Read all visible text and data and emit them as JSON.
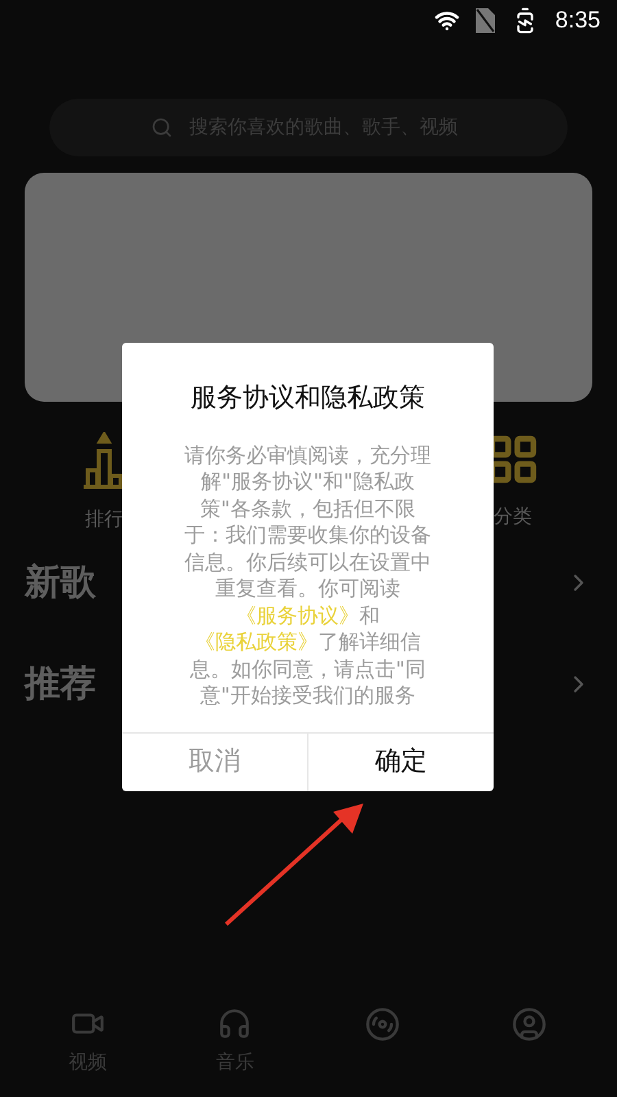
{
  "status_bar": {
    "time": "8:35"
  },
  "search": {
    "placeholder": "搜索你喜欢的歌曲、歌手、视频"
  },
  "shortcuts": [
    {
      "kind": "ranking",
      "label": "排行"
    },
    {
      "kind": "category",
      "label": "分类"
    }
  ],
  "sections": [
    {
      "title": "新歌"
    },
    {
      "title": "推荐"
    }
  ],
  "bottom_nav": [
    {
      "kind": "video",
      "label": "视频"
    },
    {
      "kind": "music",
      "label": "音乐"
    },
    {
      "kind": "disc"
    },
    {
      "kind": "profile"
    }
  ],
  "dialog": {
    "title": "服务协议和隐私政策",
    "body": [
      {
        "kind": "text",
        "text": "请你务必审慎阅读，充分理解\"服务协议\"和\"隐私政策\"各条款，包括但不限于：我们需要收集你的设备信息。你后续可以在设置中重复查看。你可阅读"
      },
      {
        "kind": "link",
        "text": "《服务协议》"
      },
      {
        "kind": "text",
        "text": "和"
      },
      {
        "kind": "link",
        "text": "《隐私政策》"
      },
      {
        "kind": "text",
        "text": "了解详细信息。如你同意，请点击\"同意\"开始接受我们的服务"
      }
    ],
    "buttons": [
      {
        "label": "取消",
        "primary": false
      },
      {
        "label": "确定",
        "primary": true
      }
    ]
  }
}
